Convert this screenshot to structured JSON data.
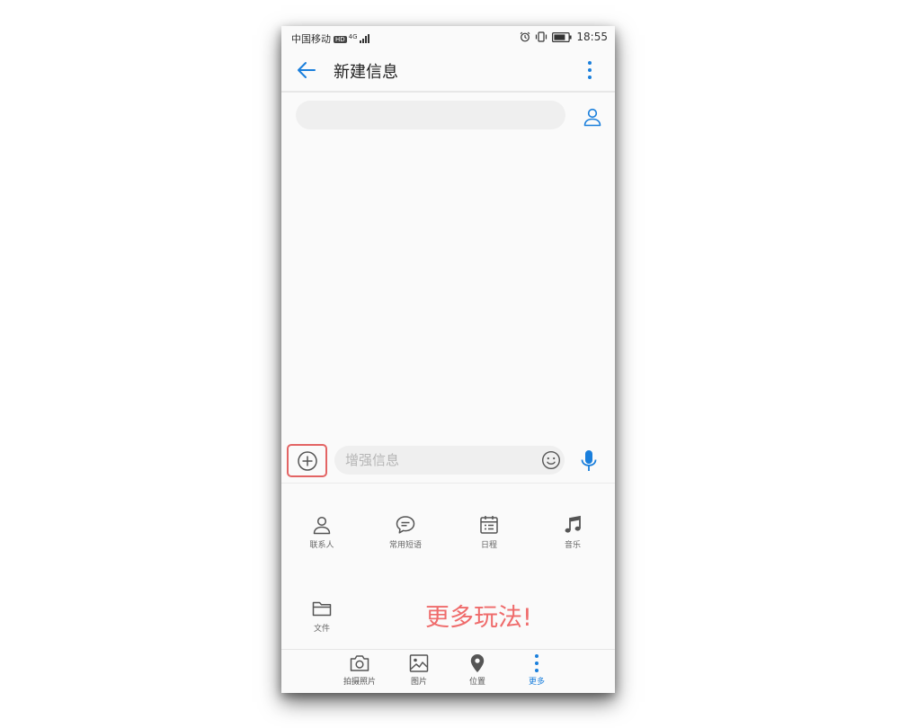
{
  "status_bar": {
    "carrier": "中国移动",
    "network_badge": "HD",
    "network_type": "4G",
    "time": "18:55",
    "icons": [
      "alarm-icon",
      "vibrate-icon",
      "battery-icon"
    ]
  },
  "header": {
    "title": "新建信息",
    "back_icon": "arrow-left-icon",
    "menu_icon": "vertical-dots-icon"
  },
  "recipient": {
    "value": "",
    "contact_icon": "person-icon"
  },
  "compose": {
    "add_icon": "circle-plus-icon",
    "placeholder": "增强信息",
    "emoji_icon": "smiley-icon",
    "mic_icon": "microphone-icon"
  },
  "attachments": [
    {
      "label": "联系人",
      "icon": "person-icon"
    },
    {
      "label": "常用短语",
      "icon": "speech-bubble-icon"
    },
    {
      "label": "日程",
      "icon": "calendar-icon"
    },
    {
      "label": "音乐",
      "icon": "music-note-icon"
    },
    {
      "label": "文件",
      "icon": "folder-icon"
    }
  ],
  "promo_text": "更多玩法!",
  "bottom_bar": [
    {
      "label": "拍摄照片",
      "icon": "camera-icon"
    },
    {
      "label": "图片",
      "icon": "image-icon"
    },
    {
      "label": "位置",
      "icon": "location-pin-icon"
    },
    {
      "label": "更多",
      "icon": "vertical-dots-icon",
      "active": true
    }
  ],
  "colors": {
    "accent": "#1a7fdc",
    "highlight": "#e36464",
    "promo": "#ef6b6b"
  }
}
